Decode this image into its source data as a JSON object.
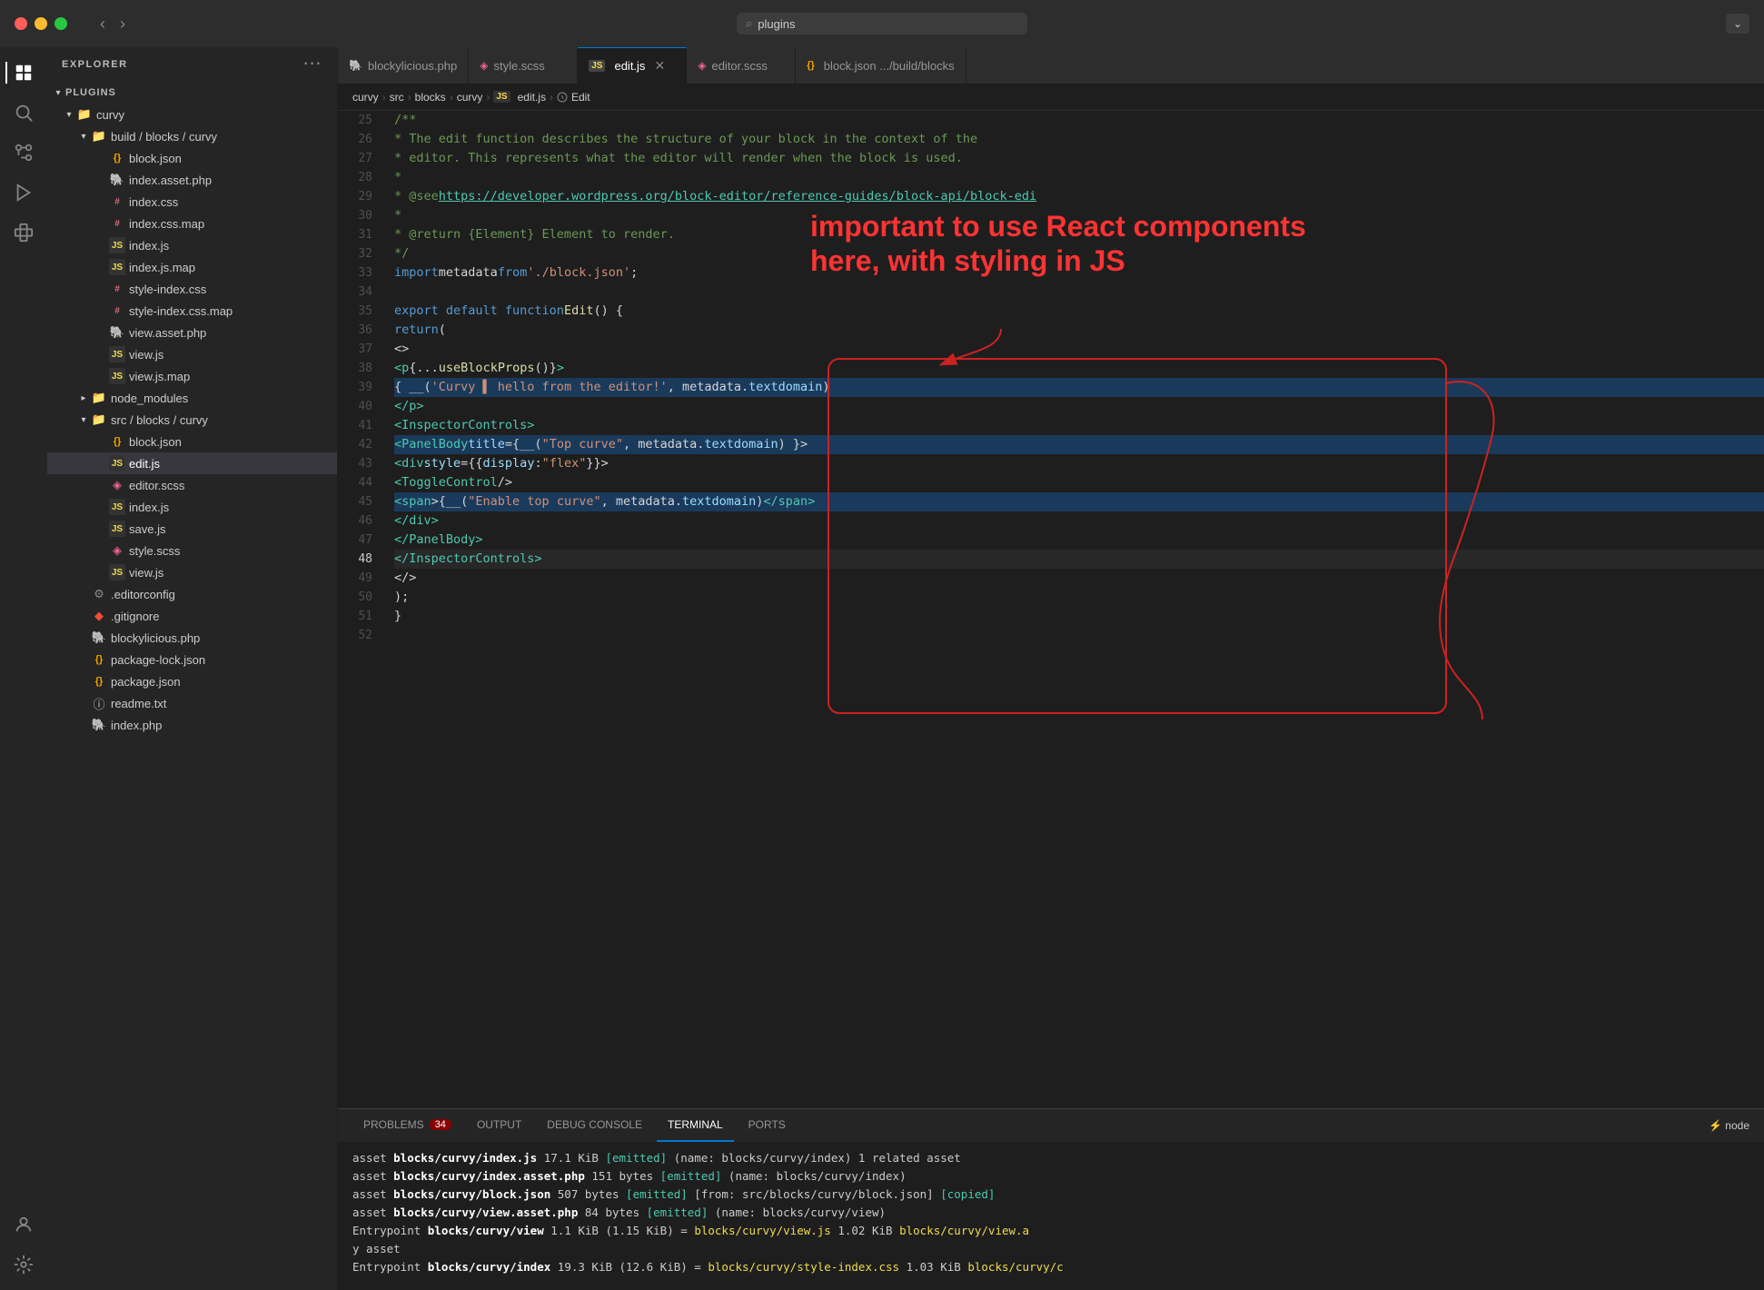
{
  "titlebar": {
    "search_placeholder": "plugins",
    "search_value": "plugins"
  },
  "tabs": [
    {
      "id": "blockylicious",
      "label": "blockylicious.php",
      "icon": "php",
      "active": false,
      "dirty": false
    },
    {
      "id": "style-scss",
      "label": "style.scss",
      "icon": "scss",
      "active": false,
      "dirty": false
    },
    {
      "id": "edit-js",
      "label": "edit.js",
      "icon": "js",
      "active": true,
      "dirty": false,
      "close": true
    },
    {
      "id": "editor-scss",
      "label": "editor.scss",
      "icon": "scss",
      "active": false,
      "dirty": false
    },
    {
      "id": "block-json",
      "label": "block.json  .../build/blocks",
      "icon": "json",
      "active": false,
      "dirty": false
    }
  ],
  "breadcrumb": [
    "curvy",
    "src",
    "blocks",
    "curvy",
    "JS edit.js",
    "Edit"
  ],
  "sidebar": {
    "title": "EXPLORER",
    "root_label": "PLUGINS",
    "tree": [
      {
        "level": 0,
        "type": "folder",
        "expanded": true,
        "label": "curvy"
      },
      {
        "level": 1,
        "type": "folder",
        "expanded": true,
        "label": "build / blocks / curvy"
      },
      {
        "level": 2,
        "type": "file",
        "icon": "json",
        "label": "block.json"
      },
      {
        "level": 2,
        "type": "file",
        "icon": "php",
        "label": "index.asset.php"
      },
      {
        "level": 2,
        "type": "file",
        "icon": "css",
        "label": "index.css"
      },
      {
        "level": 2,
        "type": "file",
        "icon": "css",
        "label": "index.css.map"
      },
      {
        "level": 2,
        "type": "file",
        "icon": "js",
        "label": "index.js"
      },
      {
        "level": 2,
        "type": "file",
        "icon": "js",
        "label": "index.js.map"
      },
      {
        "level": 2,
        "type": "file",
        "icon": "css",
        "label": "style-index.css"
      },
      {
        "level": 2,
        "type": "file",
        "icon": "css",
        "label": "style-index.css.map"
      },
      {
        "level": 2,
        "type": "file",
        "icon": "php",
        "label": "view.asset.php"
      },
      {
        "level": 2,
        "type": "file",
        "icon": "js",
        "label": "view.js"
      },
      {
        "level": 2,
        "type": "file",
        "icon": "js",
        "label": "view.js.map"
      },
      {
        "level": 1,
        "type": "folder",
        "expanded": false,
        "label": "node_modules"
      },
      {
        "level": 1,
        "type": "folder",
        "expanded": true,
        "label": "src / blocks / curvy"
      },
      {
        "level": 2,
        "type": "file",
        "icon": "json",
        "label": "block.json"
      },
      {
        "level": 2,
        "type": "file",
        "icon": "js",
        "label": "edit.js",
        "selected": true
      },
      {
        "level": 2,
        "type": "file",
        "icon": "scss",
        "label": "editor.scss"
      },
      {
        "level": 2,
        "type": "file",
        "icon": "js",
        "label": "index.js"
      },
      {
        "level": 2,
        "type": "file",
        "icon": "js",
        "label": "save.js"
      },
      {
        "level": 2,
        "type": "file",
        "icon": "scss",
        "label": "style.scss"
      },
      {
        "level": 2,
        "type": "file",
        "icon": "js",
        "label": "view.js"
      },
      {
        "level": 0,
        "type": "file",
        "icon": "config",
        "label": ".editorconfig"
      },
      {
        "level": 0,
        "type": "file",
        "icon": "git",
        "label": ".gitignore"
      },
      {
        "level": 0,
        "type": "file",
        "icon": "php",
        "label": "blockylicious.php"
      },
      {
        "level": 0,
        "type": "file",
        "icon": "json",
        "label": "package-lock.json"
      },
      {
        "level": 0,
        "type": "file",
        "icon": "json",
        "label": "package.json"
      },
      {
        "level": 0,
        "type": "file",
        "icon": "file",
        "label": "readme.txt"
      },
      {
        "level": 0,
        "type": "file",
        "icon": "php",
        "label": "index.php"
      }
    ]
  },
  "code": {
    "lines": [
      {
        "num": 25,
        "tokens": [
          {
            "t": "c-comment",
            "v": "/**"
          }
        ]
      },
      {
        "num": 26,
        "tokens": [
          {
            "t": "c-comment",
            "v": " * The edit function describes the structure of your block in the context of the"
          }
        ]
      },
      {
        "num": 27,
        "tokens": [
          {
            "t": "c-comment",
            "v": " * editor. This represents what the editor will render when the block is used."
          }
        ]
      },
      {
        "num": 28,
        "tokens": [
          {
            "t": "c-comment",
            "v": " *"
          }
        ]
      },
      {
        "num": 29,
        "tokens": [
          {
            "t": "c-comment",
            "v": " * @see "
          },
          {
            "t": "c-link",
            "v": "https://developer.wordpress.org/block-editor/reference-guides/block-api/block-edi"
          }
        ]
      },
      {
        "num": 30,
        "tokens": [
          {
            "t": "c-comment",
            "v": " *"
          }
        ]
      },
      {
        "num": 31,
        "tokens": [
          {
            "t": "c-comment",
            "v": " * @return {Element} Element to render."
          }
        ]
      },
      {
        "num": 32,
        "tokens": [
          {
            "t": "c-comment",
            "v": " */"
          }
        ]
      },
      {
        "num": 33,
        "tokens": [
          {
            "t": "c-keyword",
            "v": "import"
          },
          {
            "t": "c-plain",
            "v": " metadata "
          },
          {
            "t": "c-keyword",
            "v": "from"
          },
          {
            "t": "c-string",
            "v": " './block.json'"
          },
          {
            "t": "c-plain",
            "v": ";"
          }
        ]
      },
      {
        "num": 34,
        "tokens": []
      },
      {
        "num": 35,
        "tokens": [
          {
            "t": "c-keyword",
            "v": "export default function"
          },
          {
            "t": "c-function",
            "v": " Edit"
          },
          {
            "t": "c-plain",
            "v": "() {"
          }
        ]
      },
      {
        "num": 36,
        "tokens": [
          {
            "t": "c-plain",
            "v": "    "
          },
          {
            "t": "c-keyword",
            "v": "return"
          },
          {
            "t": "c-plain",
            "v": " ("
          }
        ]
      },
      {
        "num": 37,
        "tokens": [
          {
            "t": "c-plain",
            "v": "        <>"
          }
        ]
      },
      {
        "num": 38,
        "tokens": [
          {
            "t": "c-plain",
            "v": "            "
          },
          {
            "t": "c-tag",
            "v": "<p"
          },
          {
            "t": "c-plain",
            "v": " {"
          },
          {
            "t": "c-plain",
            "v": "..."
          },
          {
            "t": "c-function",
            "v": "useBlockProps"
          },
          {
            "t": "c-plain",
            "v": "()"
          },
          {
            "t": "c-plain",
            "v": "}"
          },
          {
            "t": "c-tag",
            "v": ">"
          }
        ]
      },
      {
        "num": 39,
        "tokens": [
          {
            "t": "c-plain",
            "v": "                { __("
          },
          {
            "t": "c-string",
            "v": "'Curvy ▌ hello from the editor!'"
          },
          {
            "t": "c-plain",
            "v": ", metadata."
          },
          {
            "t": "c-attr",
            "v": "textdomain"
          },
          {
            "t": "c-plain",
            "v": ")"
          }
        ],
        "highlight": true
      },
      {
        "num": 40,
        "tokens": [
          {
            "t": "c-plain",
            "v": "            "
          },
          {
            "t": "c-tag",
            "v": "</p>"
          }
        ]
      },
      {
        "num": 41,
        "tokens": [
          {
            "t": "c-plain",
            "v": "            "
          },
          {
            "t": "c-tag",
            "v": "<InspectorControls>"
          }
        ]
      },
      {
        "num": 42,
        "tokens": [
          {
            "t": "c-plain",
            "v": "                "
          },
          {
            "t": "c-tag",
            "v": "<PanelBody"
          },
          {
            "t": "c-plain",
            "v": " "
          },
          {
            "t": "c-attr",
            "v": "title"
          },
          {
            "t": "c-plain",
            "v": "={__("
          },
          {
            "t": "c-string",
            "v": "\"Top curve\""
          },
          {
            "t": "c-plain",
            "v": ", metadata."
          },
          {
            "t": "c-attr",
            "v": "textdomain"
          },
          {
            "t": "c-plain",
            "v": ") }>"
          }
        ],
        "highlight": true
      },
      {
        "num": 43,
        "tokens": [
          {
            "t": "c-plain",
            "v": "                    "
          },
          {
            "t": "c-tag",
            "v": "<div"
          },
          {
            "t": "c-plain",
            "v": " "
          },
          {
            "t": "c-attr",
            "v": "style"
          },
          {
            "t": "c-plain",
            "v": "={{"
          },
          {
            "t": "c-attr",
            "v": "display"
          },
          {
            "t": "c-plain",
            "v": ": "
          },
          {
            "t": "c-string",
            "v": "\"flex\""
          },
          {
            "t": "c-plain",
            "v": "}}>"
          }
        ]
      },
      {
        "num": 44,
        "tokens": [
          {
            "t": "c-plain",
            "v": "                        "
          },
          {
            "t": "c-tag",
            "v": "<ToggleControl"
          },
          {
            "t": "c-plain",
            "v": " />"
          }
        ]
      },
      {
        "num": 45,
        "tokens": [
          {
            "t": "c-plain",
            "v": "                        "
          },
          {
            "t": "c-tag",
            "v": "<span"
          },
          {
            "t": "c-plain",
            "v": ">{__("
          },
          {
            "t": "c-string",
            "v": "\"Enable top curve\""
          },
          {
            "t": "c-plain",
            "v": ", metadata."
          },
          {
            "t": "c-attr",
            "v": "textdomain"
          },
          {
            "t": "c-plain",
            "v": ")"
          },
          {
            "t": "c-tag",
            "v": "</span>"
          }
        ],
        "highlight": true
      },
      {
        "num": 46,
        "tokens": [
          {
            "t": "c-plain",
            "v": "                    "
          },
          {
            "t": "c-tag",
            "v": "</div>"
          }
        ]
      },
      {
        "num": 47,
        "tokens": [
          {
            "t": "c-plain",
            "v": "                "
          },
          {
            "t": "c-tag",
            "v": "</PanelBody>"
          }
        ]
      },
      {
        "num": 48,
        "tokens": [
          {
            "t": "c-plain",
            "v": "            "
          },
          {
            "t": "c-tag",
            "v": "</InspectorControls>"
          }
        ],
        "active": true
      },
      {
        "num": 49,
        "tokens": [
          {
            "t": "c-plain",
            "v": "        </>"
          }
        ]
      },
      {
        "num": 50,
        "tokens": [
          {
            "t": "c-plain",
            "v": "    );"
          }
        ]
      },
      {
        "num": 51,
        "tokens": [
          {
            "t": "c-plain",
            "v": "}"
          }
        ]
      },
      {
        "num": 52,
        "tokens": []
      }
    ]
  },
  "panel": {
    "tabs": [
      "PROBLEMS",
      "OUTPUT",
      "DEBUG CONSOLE",
      "TERMINAL",
      "PORTS"
    ],
    "active_tab": "TERMINAL",
    "problems_count": 34,
    "terminal_label": "node",
    "terminal_lines": [
      "asset <b>blocks/curvy/index.js</b> 17.1 KiB <span class='t-green'>[emitted]</span> (name: blocks/curvy/index) 1 related asset",
      "asset <b>blocks/curvy/index.asset.php</b> 151 bytes <span class='t-green'>[emitted]</span> (name: blocks/curvy/index)",
      "asset <b>blocks/curvy/block.json</b> 507 bytes <span class='t-green'>[emitted]</span> [from: src/blocks/curvy/block.json] <span class='t-green'>[copied]</span>",
      "asset <b>blocks/curvy/view.asset.php</b> 84 bytes <span class='t-green'>[emitted]</span> (name: blocks/curvy/view)",
      "Entrypoint <b>blocks/curvy/view</b> 1.1 KiB (1.15 KiB) = <span class='t-yellow'>blocks/curvy/view.js</span> 1.02 KiB <span class='t-yellow'>blocks/curvy/view.a</span>",
      "y asset",
      "Entrypoint <b>blocks/curvy/index</b> 19.3 KiB (12.6 KiB) = <span class='t-yellow'>blocks/curvy/style-index.css</span> 1.03 KiB <span class='t-yellow'>blocks/curvy/c</span>"
    ]
  },
  "annotation_text": "important to use React components here, with styling in JS"
}
